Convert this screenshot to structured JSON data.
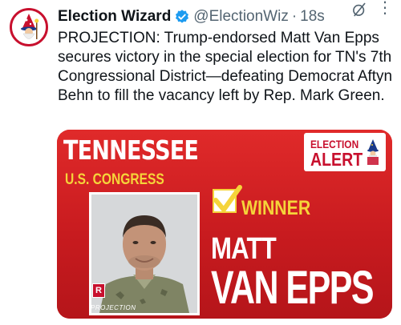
{
  "tweet": {
    "display_name": "Election Wizard",
    "handle": "@ElectionWiz",
    "separator": "·",
    "time": "18s",
    "text": "PROJECTION: Trump-endorsed Matt Van Epps secures victory in the special election for TN's 7th Congressional District—defeating Democrat Aftyn Behn to fill the vacancy left by Rep. Mark Green.",
    "icons": [
      "avatar-wizard",
      "verified-badge-icon",
      "grok-icon",
      "more-icon"
    ]
  },
  "card": {
    "state": "TENNESSEE",
    "race": "U.S. CONGRESS",
    "alert_line1": "ELECTION",
    "alert_line2": "ALERT",
    "winner_label": "WINNER",
    "first_name": "MATT",
    "last_name": "VAN EPPS",
    "party": "R",
    "projection": "PROJECTION",
    "colors": {
      "background": "#d01f22",
      "accent": "#f5d43a",
      "text": "#ffffff",
      "verified": "#1d9bf0"
    }
  }
}
